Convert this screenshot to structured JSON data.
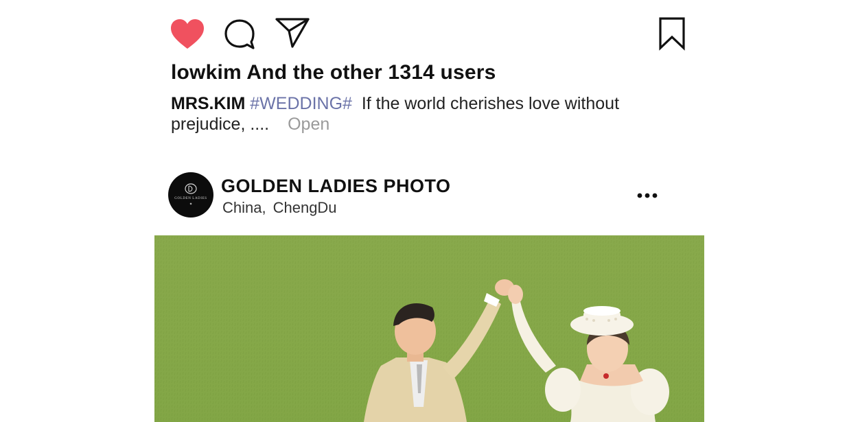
{
  "actions": {
    "like_icon": "heart-filled-icon",
    "comment_icon": "comment-icon",
    "share_icon": "send-icon",
    "bookmark_icon": "bookmark-icon",
    "like_color": "#f0515f"
  },
  "likes_line": "lowkim And the other 1314 users",
  "caption": {
    "author": "MRS.KIM",
    "hashtag": "#WEDDING#",
    "text": "If the world cherishes love without prejudice, ....",
    "open_label": "Open"
  },
  "post_header": {
    "avatar_brand": "GOLDEN LADIES",
    "account_name": "GOLDEN LADIES PHOTO",
    "location_country": "China,",
    "location_city": "ChengDu",
    "more_icon": "more-horizontal-icon"
  },
  "photo": {
    "subject": "couple-dancing-on-grass",
    "accent_grass": "#86a849"
  }
}
